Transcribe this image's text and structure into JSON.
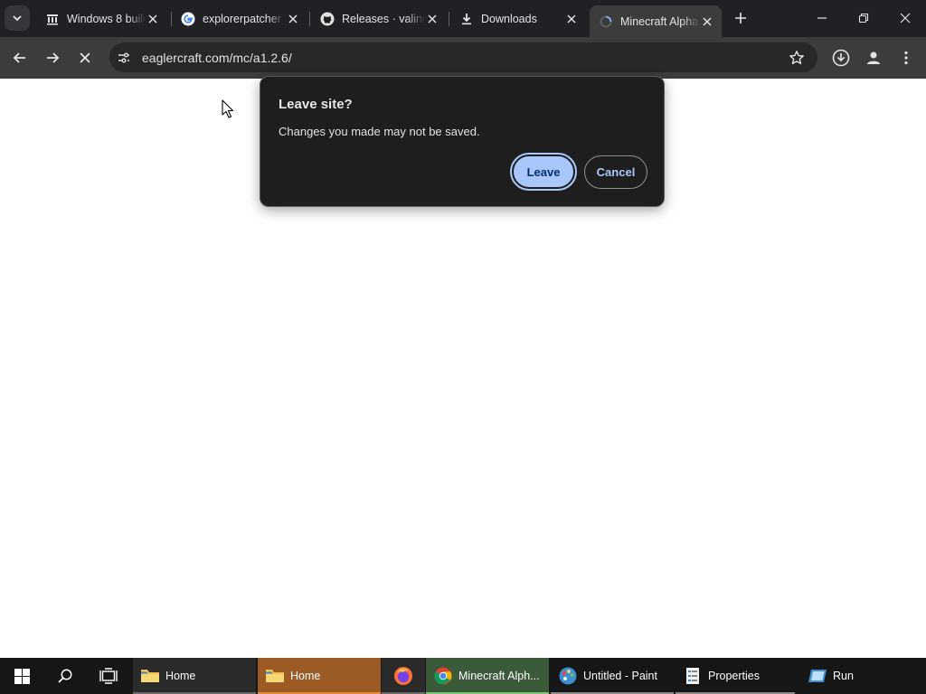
{
  "browser": {
    "tabs": [
      {
        "title": "Windows 8 build",
        "favicon": "library-icon",
        "active": false
      },
      {
        "title": "explorerpatcher",
        "favicon": "google-icon",
        "active": false
      },
      {
        "title": "Releases · valinet",
        "favicon": "github-icon",
        "active": false
      },
      {
        "title": "Downloads",
        "favicon": "download-icon",
        "active": false
      },
      {
        "title": "Minecraft Alpha",
        "favicon": "loading-spinner-icon",
        "active": true
      }
    ],
    "address": {
      "url": "eaglercraft.com/mc/a1.2.6/"
    }
  },
  "dialog": {
    "title": "Leave site?",
    "message": "Changes you made may not be saved.",
    "leave_label": "Leave",
    "cancel_label": "Cancel"
  },
  "taskbar": {
    "items": [
      {
        "label": "Home",
        "icon": "folder-icon"
      },
      {
        "label": "Home",
        "icon": "folder-icon"
      },
      {
        "label": "",
        "icon": "firefox-icon"
      },
      {
        "label": "Minecraft Alph...",
        "icon": "chrome-icon"
      },
      {
        "label": "Untitled - Paint",
        "icon": "paint-icon"
      },
      {
        "label": "Properties",
        "icon": "properties-icon"
      },
      {
        "label": "Run",
        "icon": "run-icon"
      }
    ]
  },
  "colors": {
    "tabstrip": "#202124",
    "toolbar": "#3c3c3c",
    "dialog_bg": "#1e1e1e",
    "accent": "#a8c7fa",
    "taskbar": "#161616",
    "home_active_bg": "#9c5a24",
    "chrome_active_bg": "#3b5a3a"
  }
}
